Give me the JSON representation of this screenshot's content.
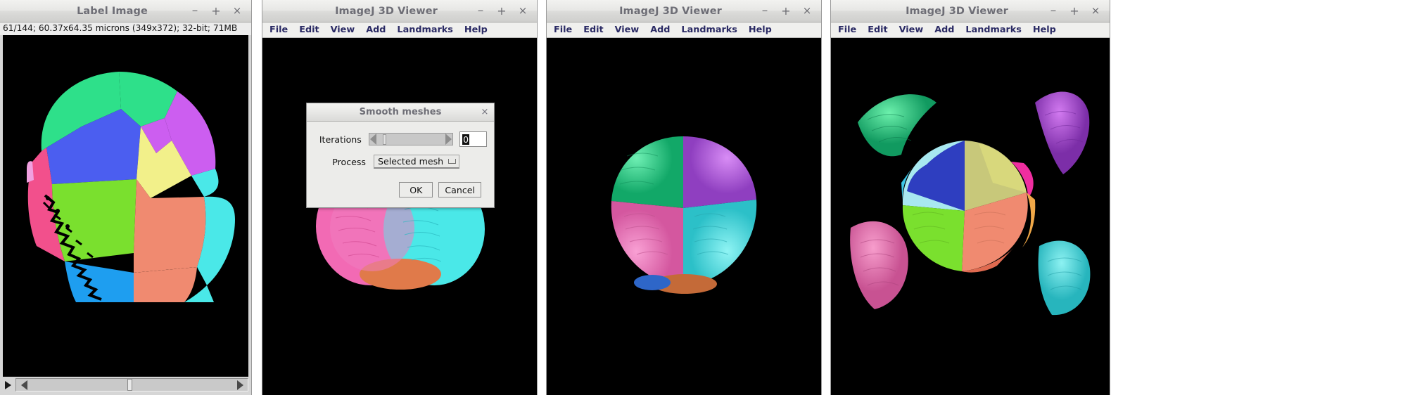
{
  "windows": [
    {
      "id": "label-image",
      "title": "Label Image",
      "status": "61/144; 60.37x64.35 microns (349x372); 32-bit; 71MB",
      "controls": {
        "minimize": "–",
        "maximize": "+",
        "close": "×"
      },
      "scrollbar": {
        "play": "play-icon",
        "left_arrow": "left-arrow-icon",
        "right_arrow": "right-arrow-icon"
      }
    },
    {
      "id": "viewer-1",
      "title": "ImageJ 3D Viewer",
      "controls": {
        "minimize": "–",
        "maximize": "+",
        "close": "×"
      },
      "menu": [
        "File",
        "Edit",
        "View",
        "Add",
        "Landmarks",
        "Help"
      ]
    },
    {
      "id": "viewer-2",
      "title": "ImageJ 3D Viewer",
      "controls": {
        "minimize": "–",
        "maximize": "+",
        "close": "×"
      },
      "menu": [
        "File",
        "Edit",
        "View",
        "Add",
        "Landmarks",
        "Help"
      ]
    },
    {
      "id": "viewer-3",
      "title": "ImageJ 3D Viewer",
      "controls": {
        "minimize": "–",
        "maximize": "+",
        "close": "×"
      },
      "menu": [
        "File",
        "Edit",
        "View",
        "Add",
        "Landmarks",
        "Help"
      ]
    }
  ],
  "dialog": {
    "title": "Smooth meshes",
    "close": "×",
    "iterations": {
      "label": "Iterations",
      "value": "0"
    },
    "process": {
      "label": "Process",
      "value": "Selected mesh"
    },
    "buttons": {
      "ok": "OK",
      "cancel": "Cancel"
    }
  },
  "colors": {
    "green": "#2ee08a",
    "blue": "#4b5ef0",
    "magenta": "#cc5ef0",
    "yellow": "#f2f08a",
    "lightgreen": "#7ae02e",
    "salmon": "#f08a70",
    "cyan": "#4ae8e8",
    "pink": "#f2508c",
    "skyblue": "#1e9ef0",
    "lavender": "#f0a0e0",
    "window_bg": "#d6d6d6",
    "titlebar": "#e8e8e6",
    "menu_text": "#2a2a64",
    "canvas": "#000000"
  }
}
